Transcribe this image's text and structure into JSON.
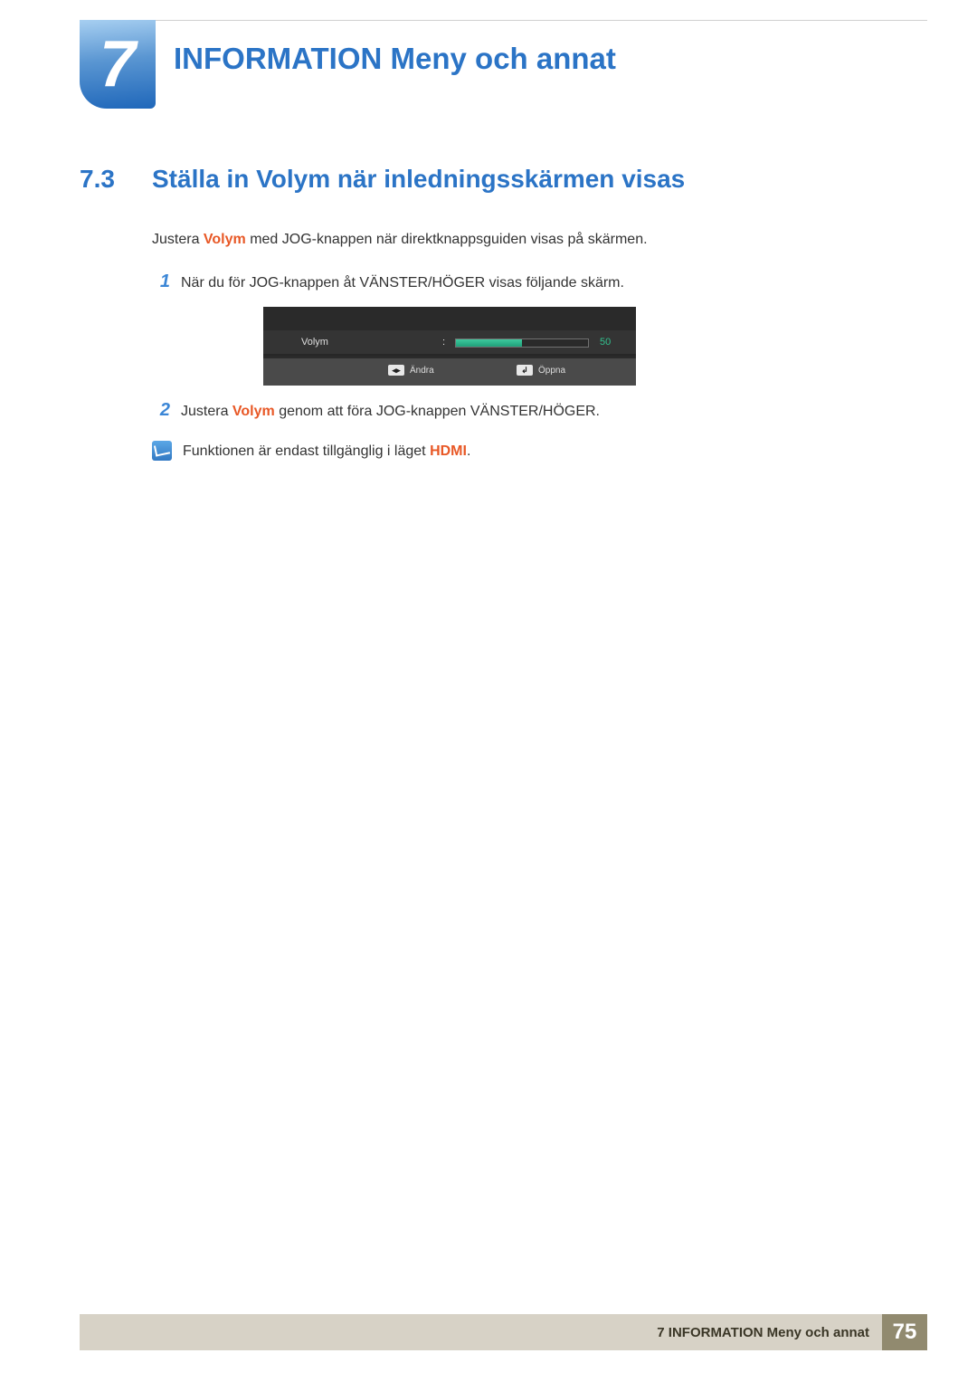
{
  "chapter": {
    "number": "7",
    "title": "INFORMATION Meny och annat"
  },
  "section": {
    "number": "7.3",
    "title": "Ställa in Volym när inledningsskärmen visas"
  },
  "intro": {
    "prefix": "Justera ",
    "bold": "Volym",
    "suffix": " med JOG-knappen när direktknappsguiden visas på skärmen."
  },
  "steps": [
    {
      "num": "1",
      "text": "När du för JOG-knappen åt VÄNSTER/HÖGER visas följande skärm."
    },
    {
      "num": "2",
      "prefix": "Justera ",
      "bold": "Volym",
      "suffix": " genom att föra JOG-knappen VÄNSTER/HÖGER."
    }
  ],
  "osd": {
    "label": "Volym",
    "colon": ":",
    "value": "50",
    "fillPercent": 50,
    "foot_left_key": "◂▸",
    "foot_left_label": "Ändra",
    "foot_right_key": "↲",
    "foot_right_label": "Öppna"
  },
  "note": {
    "prefix": "Funktionen är endast tillgänglig i läget ",
    "bold": "HDMI",
    "suffix": "."
  },
  "footer": {
    "text": "7 INFORMATION Meny och annat",
    "page": "75"
  }
}
